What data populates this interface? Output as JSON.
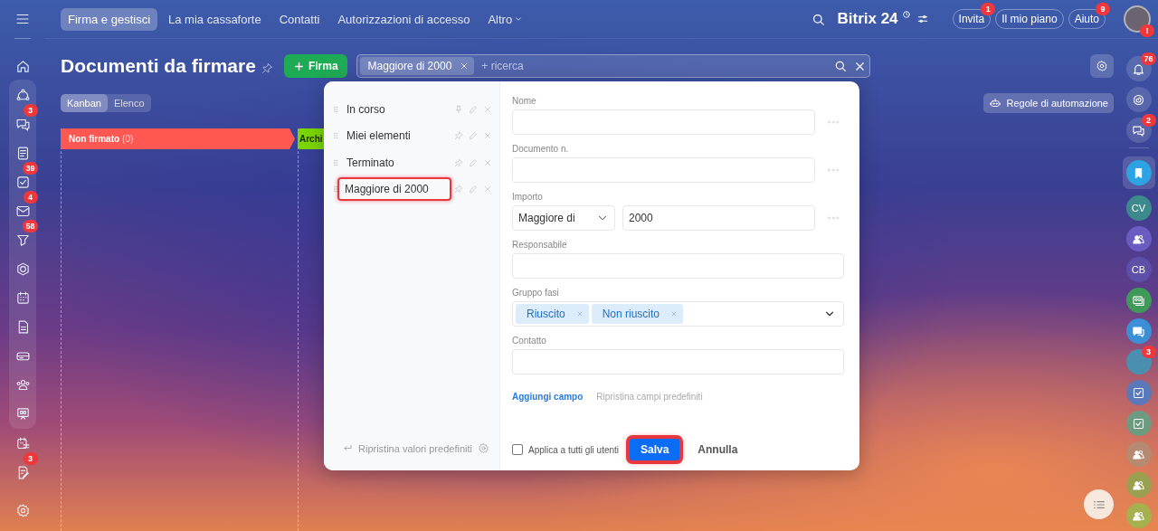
{
  "left_sidebar": {
    "top_items": [
      {
        "kind": "home"
      }
    ],
    "group_items": [
      {
        "kind": "flow"
      },
      {
        "kind": "chat",
        "badge": "3"
      },
      {
        "kind": "feed"
      },
      {
        "kind": "tasks",
        "badge": "39"
      },
      {
        "kind": "mail",
        "badge": "4"
      },
      {
        "kind": "funnel",
        "badge": "58"
      },
      {
        "kind": "hexagon"
      },
      {
        "kind": "calendar"
      },
      {
        "kind": "file"
      },
      {
        "kind": "drive"
      },
      {
        "kind": "people"
      },
      {
        "kind": "board"
      }
    ],
    "bottom_items": [
      {
        "kind": "calendar-list"
      },
      {
        "kind": "sign",
        "badge": "3"
      },
      {
        "kind": "settings"
      }
    ]
  },
  "topbar": {
    "tabs": [
      {
        "label": "Firma e gestisci",
        "selected": true,
        "has_menu": false
      },
      {
        "label": "La mia cassaforte",
        "selected": false,
        "has_menu": false
      },
      {
        "label": "Contatti",
        "selected": false,
        "has_menu": false
      },
      {
        "label": "Autorizzazioni di accesso",
        "selected": false,
        "has_menu": false
      },
      {
        "label": "Altro",
        "selected": false,
        "has_menu": true
      }
    ],
    "logo": {
      "name": "Bitrix",
      "number": "24"
    },
    "buttons": [
      {
        "label": "Invita",
        "badge": "1"
      },
      {
        "label": "Il mio piano"
      },
      {
        "label": "Aiuto",
        "badge": "9"
      }
    ],
    "avatar": {
      "badge": "!"
    }
  },
  "page": {
    "title": "Documenti da firmare",
    "create_button": "Firma",
    "search": {
      "chips": [
        "Maggiore di 2000"
      ],
      "placeholder": "+ ricerca"
    },
    "views": [
      {
        "label": "Kanban",
        "selected": true
      },
      {
        "label": "Elenco",
        "selected": false
      }
    ],
    "automation_button": "Regole di automazione",
    "stages": [
      {
        "name": "Non firmato",
        "count": "(0)",
        "color": "#ff5752"
      },
      {
        "name": "Archi",
        "color": "#7bd500"
      }
    ]
  },
  "filter_popup": {
    "presets": [
      {
        "label": "In corso",
        "pinned": true,
        "highlighted": false
      },
      {
        "label": "Miei elementi",
        "pinned": false,
        "highlighted": false
      },
      {
        "label": "Terminato",
        "pinned": false,
        "highlighted": false
      },
      {
        "label": "Maggiore di 2000",
        "pinned": false,
        "highlighted": true
      }
    ],
    "reset_link": "Ripristina valori predefiniti",
    "fields": [
      {
        "kind": "text",
        "label": "Nome",
        "has_menu": true
      },
      {
        "kind": "text",
        "label": "Documento n.",
        "has_menu": true
      },
      {
        "kind": "range",
        "label": "Importo",
        "operator": "Maggiore di",
        "value": "2000",
        "has_menu": true
      },
      {
        "kind": "text",
        "label": "Responsabile",
        "has_menu": false
      },
      {
        "kind": "tags",
        "label": "Gruppo fasi",
        "tags": [
          "Riuscito",
          "Non riuscito"
        ],
        "has_menu": false
      },
      {
        "kind": "text",
        "label": "Contatto",
        "has_menu": false
      }
    ],
    "add_field_link": "Aggiungi campo",
    "restore_fields_link": "Ripristina campi predefiniti",
    "apply_all": {
      "label": "Applica a tutti gli utenti",
      "checked": false
    },
    "save_button": {
      "label": "Salva",
      "highlighted": true
    },
    "cancel_button": "Annulla"
  },
  "right_sidebar": {
    "items": [
      {
        "kind": "bell",
        "badge": "76",
        "selected": false
      },
      {
        "kind": "spiral",
        "selected": false
      },
      {
        "kind": "chat",
        "badge": "2",
        "selected": false
      },
      {
        "kind": "bookmark",
        "color": "#2ea3e3",
        "selected": true
      },
      {
        "kind": "initials",
        "initials": "CV",
        "color": "#3d8a8c",
        "selected": false
      },
      {
        "kind": "group",
        "color": "#6a5cc0",
        "selected": false
      },
      {
        "kind": "initials",
        "initials": "CB",
        "color": "#5e4fa8",
        "selected": false
      },
      {
        "kind": "contact-card",
        "color": "#3f9a5a",
        "selected": false
      },
      {
        "kind": "speech",
        "color": "#3a8fd6",
        "selected": false
      },
      {
        "kind": "photo",
        "badge": "3",
        "color": "#4a8fb0",
        "selected": false
      },
      {
        "kind": "check",
        "color": "#5b78b8",
        "selected": false
      },
      {
        "kind": "check",
        "color": "#6e9a80",
        "selected": false
      },
      {
        "kind": "group",
        "color": "#b58a70",
        "selected": false
      },
      {
        "kind": "group",
        "color": "#99a050",
        "selected": false
      },
      {
        "kind": "group",
        "color": "#a6b04e",
        "selected": false
      }
    ]
  }
}
